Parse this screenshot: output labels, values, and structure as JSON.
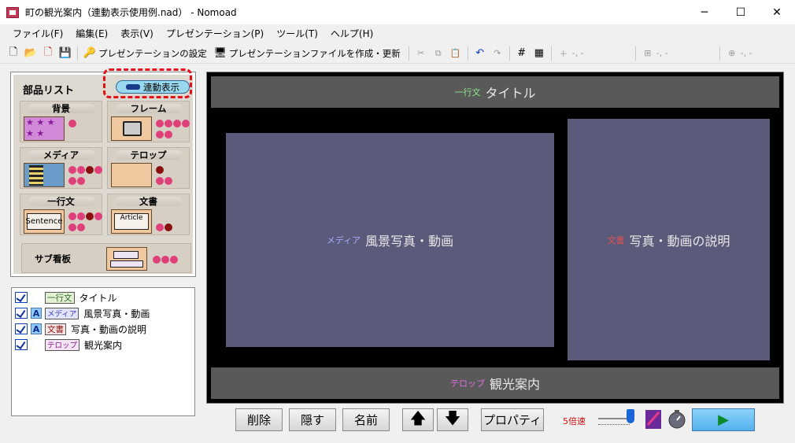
{
  "window": {
    "title": "町の観光案内（連動表示使用例.nad） - Nomoad",
    "minimize": "─",
    "maximize": "☐",
    "close": "✕"
  },
  "menu": [
    "ファイル(F)",
    "編集(E)",
    "表示(V)",
    "プレゼンテーション(P)",
    "ツール(T)",
    "ヘルプ(H)"
  ],
  "toolbar": {
    "presentation_settings": "プレゼンテーションの設定",
    "create_update": "プレゼンテーションファイルを作成・更新",
    "coord1": "-, -",
    "coord2": "-, -",
    "coord3": "-, -"
  },
  "parts": {
    "title": "部品リスト",
    "link_button": "連動表示",
    "cards": {
      "bg": "背景",
      "frame": "フレーム",
      "media": "メディア",
      "telop": "テロップ",
      "oneline": "一行文",
      "doc": "文書",
      "sub": "サブ看板"
    },
    "sentence_thumb": "Sentence",
    "article_thumb": "Article"
  },
  "layers": [
    {
      "tag": "一行文",
      "name": "タイトル",
      "anchor": ""
    },
    {
      "tag": "メディア",
      "name": "風景写真・動画",
      "anchor": "A"
    },
    {
      "tag": "文書",
      "name": "写真・動画の説明",
      "anchor": "A"
    },
    {
      "tag": "テロップ",
      "name": "観光案内",
      "anchor": ""
    }
  ],
  "stage": {
    "title_tag": "一行文",
    "title_text": "タイトル",
    "media_tag": "メディア",
    "media_text": "風景写真・動画",
    "doc_tag": "文書",
    "doc_text": "写真・動画の説明",
    "telop_tag": "テロップ",
    "telop_text": "観光案内"
  },
  "bottom": {
    "delete": "削除",
    "hide": "隠す",
    "name": "名前",
    "properties": "プロパティ",
    "speed": "5倍速",
    "speed_value": 5,
    "play": "▶"
  },
  "colors": {
    "link_highlight": "#e3101a",
    "stage_box": "#5a5a7a",
    "tag_oneline": "#90e890",
    "tag_media": "#a8a8ff",
    "tag_doc": "#e85050",
    "tag_telop": "#e070e0"
  }
}
